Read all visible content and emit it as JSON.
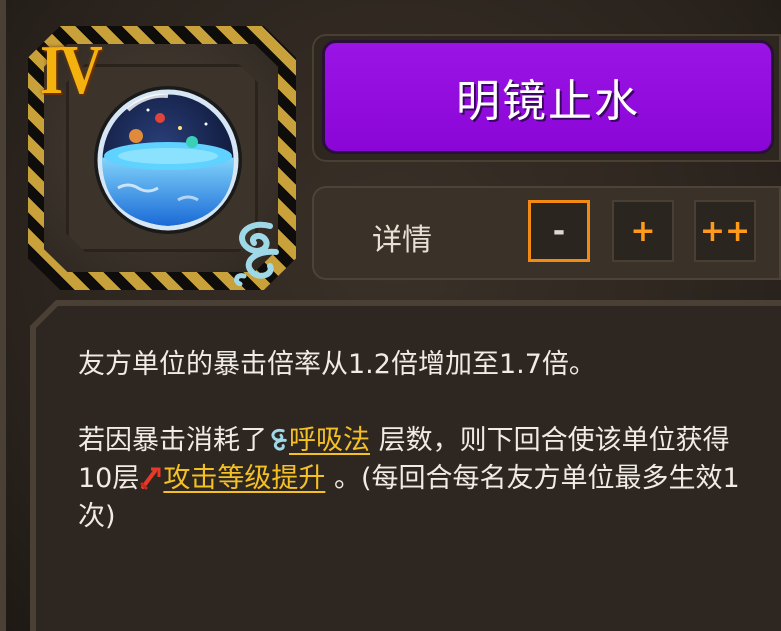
{
  "skill": {
    "tier": "IV",
    "name": "明镜止水",
    "icon": "water-orb-icon",
    "badge_icon": "breath-swirl-icon"
  },
  "level_controls": {
    "detail_label": "详情",
    "minus_label": "-",
    "plus_label": "+",
    "plus_plus_label": "++",
    "active": "minus"
  },
  "description": {
    "line1": "友方单位的暴击倍率从1.2倍增加至1.7倍。",
    "p2_a": "若因暴击消耗了",
    "p2_kw1": "呼吸法",
    "p2_b": " 层数，则下回合使该单位获得10层",
    "p2_kw2": "攻击等级提升",
    "p2_c": " 。(每回合每名友方单位最多生效1次)",
    "kw1_icon": "breath-swirl-icon",
    "kw2_icon": "attack-up-icon"
  },
  "colors": {
    "accent_purple": "#8a06d6",
    "keyword_gold": "#f5c024",
    "button_orange": "#ff9a1a",
    "tier_gold": "#f3b20e"
  }
}
